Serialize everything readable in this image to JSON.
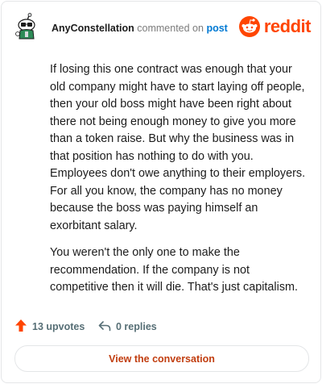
{
  "header": {
    "username": "AnyConstellation",
    "verb": "commented on",
    "target_link": "post",
    "brand_word": "reddit",
    "avatar_icon": "snoo-avatar-icon",
    "brand_icon": "reddit-logo-icon",
    "brand_color": "#ff4500"
  },
  "comment": {
    "paragraphs": [
      "If losing this one contract was enough that your old company might have to start laying off people, then your old boss might have been right about there not being enough money to give you more than a token raise. But why the business was in that position has nothing to do with you. Employees don't owe anything to their employers. For all you know, the company has no money because the boss was paying himself an exorbitant salary.",
      "You weren't the only one to make the recommendation. If the company is not competitive then it will die. That's just capitalism."
    ]
  },
  "footer": {
    "upvotes_label": "13 upvotes",
    "replies_label": "0 replies",
    "upvote_icon": "upvote-arrow-icon",
    "reply_icon": "reply-arrow-icon"
  },
  "cta": {
    "label": "View the conversation"
  }
}
